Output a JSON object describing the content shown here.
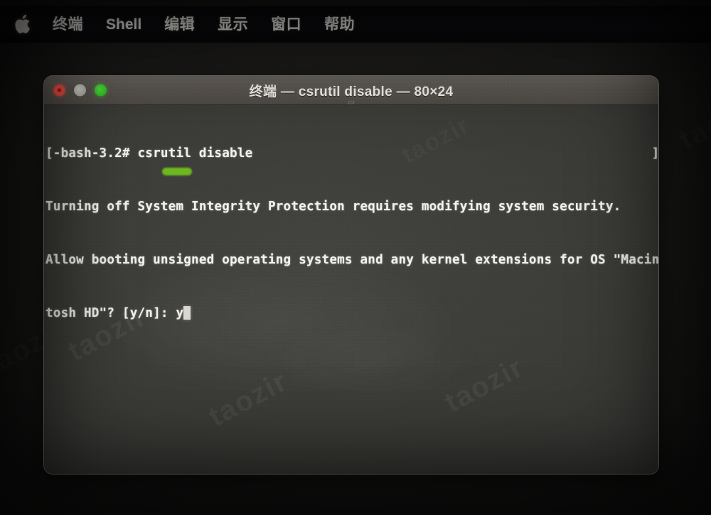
{
  "menubar": {
    "apple_icon": "apple-logo-icon",
    "items": [
      {
        "label": "终端",
        "name": "menu-terminal"
      },
      {
        "label": "Shell",
        "name": "menu-shell"
      },
      {
        "label": "编辑",
        "name": "menu-edit"
      },
      {
        "label": "显示",
        "name": "menu-view"
      },
      {
        "label": "窗口",
        "name": "menu-window"
      },
      {
        "label": "帮助",
        "name": "menu-help"
      }
    ]
  },
  "window": {
    "title": "终端 — csrutil disable — 80×24",
    "app_name": "终端",
    "command": "csrutil disable",
    "size": "80×24",
    "traffic_lights": {
      "close_label": "close",
      "minimize_label": "minimize",
      "zoom_label": "zoom"
    }
  },
  "terminal": {
    "lines": [
      "[-bash-3.2# csrutil disable                                                    ]",
      "Turning off System Integrity Protection requires modifying system security.",
      "Allow booting unsigned operating systems and any kernel extensions for OS \"Macin",
      "tosh HD\"? [y/n]: y"
    ],
    "prompt": "[-bash-3.2#",
    "typed_command": "csrutil disable",
    "answer": "y",
    "cursor": "block-cursor"
  },
  "annotations": {
    "highlight_color": "#6fbf1d",
    "highlight_target": "typed-answer-y"
  },
  "watermarks": [
    {
      "text": "taozir"
    },
    {
      "text": "taozir"
    },
    {
      "text": "taozir"
    },
    {
      "text": "taozir"
    },
    {
      "text": "taozir"
    },
    {
      "text": "taozir"
    }
  ],
  "colors": {
    "desktop": "#201f1d",
    "menubar": "#0a0a0c",
    "titlebar": "#5b5650",
    "terminal_bg": "#3c3c38",
    "terminal_fg": "#f2f1ec",
    "close": "#e8463a",
    "minimize": "#b4b1aa",
    "zoom": "#2fcd22"
  }
}
